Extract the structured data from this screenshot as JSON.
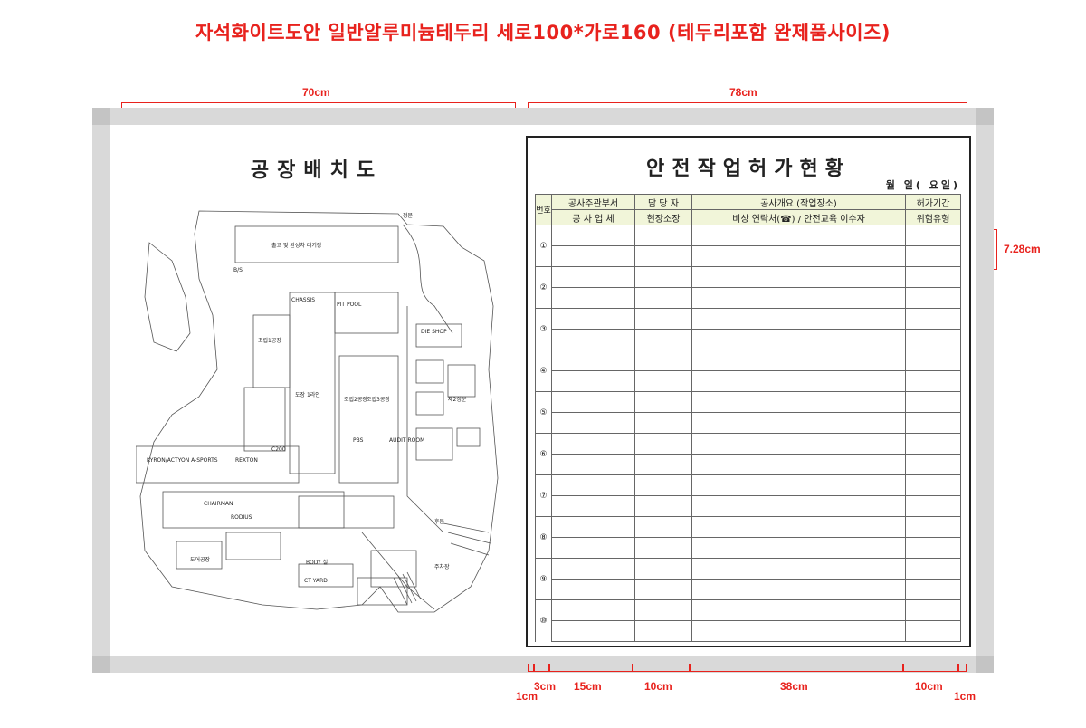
{
  "header": {
    "title": "자석화이트도안  일반알루미늄테두리  세로100*가로160 (테두리포함 완제품사이즈)"
  },
  "dimensions": {
    "top_left": "70cm",
    "top_right": "78cm",
    "side": "7.28cm",
    "bottom": [
      "1cm",
      "3cm",
      "15cm",
      "10cm",
      "38cm",
      "10cm",
      "1cm"
    ]
  },
  "left_panel": {
    "title": "공장배치도",
    "map_labels": [
      "출고 및 완성차 대기장",
      "PBS",
      "도장 1라인",
      "조립1공장",
      "조립2공장",
      "조립3공장",
      "KYRON/ACTYON A-SPORTS",
      "REXTON",
      "CHAIRMAN",
      "RODIUS",
      "BODY 실",
      "CT YARD",
      "도어공장",
      "정문",
      "후문",
      "C200",
      "CHASSIS",
      "AUDIT ROOM",
      "주차장",
      "B/S",
      "DIE SHOP",
      "PIT POOL",
      "제2정문"
    ]
  },
  "permit_board": {
    "title": "안전작업허가현황",
    "date_line": "월   일(   요일)",
    "header_row1": [
      "번호",
      "공사주관부서",
      "담 당 자",
      "공사개요 (작업장소)",
      "허가기간"
    ],
    "header_row2": [
      "공 사 업 체",
      "현장소장",
      "비상 연락처(☎) / 안전교육 이수자",
      "위험유형"
    ],
    "rows": [
      "①",
      "②",
      "③",
      "④",
      "⑤",
      "⑥",
      "⑦",
      "⑧",
      "⑨",
      "⑩"
    ]
  },
  "colors": {
    "accent": "#e8221d",
    "frame": "#d9d9d9",
    "header_fill": "#f1f5d9"
  }
}
